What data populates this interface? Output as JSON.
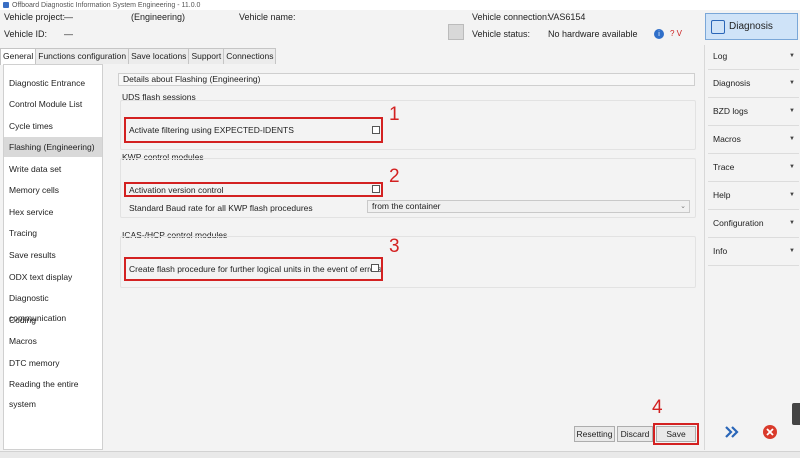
{
  "window": {
    "title": "Offboard Diagnostic Information System Engineering - 11.0.0"
  },
  "vehicle_info": {
    "project_label": "Vehicle project:",
    "project_value": "—",
    "mode_value": "(Engineering)",
    "name_label": "Vehicle name:",
    "id_label": "Vehicle ID:",
    "id_value": "—",
    "connection_label": "Vehicle connection:",
    "connection_value": "VAS6154",
    "status_label": "Vehicle status:",
    "status_value": "No hardware available",
    "help_text": "? V"
  },
  "diagnosis_button": "Diagnosis",
  "tabs": [
    {
      "label": "General"
    },
    {
      "label": "Functions configuration"
    },
    {
      "label": "Save locations"
    },
    {
      "label": "Support"
    },
    {
      "label": "Connections"
    }
  ],
  "nav": [
    "Diagnostic Entrance",
    "Control Module List",
    "Cycle times",
    "Flashing (Engineering)",
    "Write data set",
    "Memory cells",
    "Hex service",
    "Tracing",
    "Save results",
    "ODX text display",
    "Diagnostic communication",
    "Coding",
    "Macros",
    "DTC memory",
    "Reading the entire system"
  ],
  "main": {
    "title": "Details about Flashing (Engineering)",
    "uds": {
      "title": "UDS flash sessions",
      "option": "Activate filtering using EXPECTED-IDENTS",
      "marker": "1"
    },
    "kwp": {
      "title": "KWP control modules",
      "option": "Activation version control",
      "marker": "2",
      "baud_label": "Standard Baud rate for all KWP flash procedures",
      "baud_value": "from the container"
    },
    "icas": {
      "title": "ICAS-/HCP control modules",
      "option": "Create flash procedure for further logical units in the event of errors",
      "marker": "3"
    },
    "buttons": {
      "resetting": "Resetting",
      "discard": "Discard",
      "save": "Save",
      "marker": "4"
    }
  },
  "right_panel": [
    "Log",
    "Diagnosis",
    "BZD logs",
    "Macros",
    "Trace",
    "Help",
    "Configuration",
    "Info"
  ],
  "colors": {
    "accent": "#2a66b8",
    "highlight": "#d32121"
  }
}
